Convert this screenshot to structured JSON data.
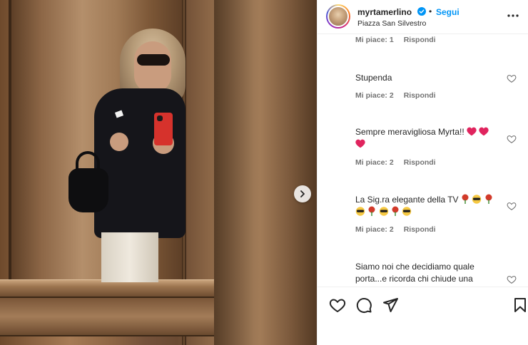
{
  "post": {
    "username": "myrtamerlino",
    "follow_label": "Segui",
    "separator": "•",
    "location": "Piazza San Silvestro"
  },
  "comments": [
    {
      "text": "",
      "likes_label": "Mi piace: 1",
      "reply_label": "Rispondi"
    },
    {
      "text": "Stupenda",
      "likes_label": "Mi piace: 2",
      "reply_label": "Rispondi"
    },
    {
      "text": "Sempre meravigliosa Myrta!!",
      "likes_label": "Mi piace: 2",
      "reply_label": "Rispondi"
    },
    {
      "text": "La Sig.ra elegante della TV",
      "likes_label": "Mi piace: 2",
      "reply_label": "Rispondi"
    },
    {
      "text_line1": "Siamo noi che decidiamo quale",
      "text_line2": "porta...e ricorda chi chiude una"
    }
  ],
  "icons": {
    "verified": "verified-badge-icon",
    "more": "more-options-icon",
    "next": "chevron-right-icon",
    "like": "heart-icon",
    "comment": "comment-icon",
    "share": "paper-plane-icon",
    "save": "bookmark-icon",
    "heart_emoji": "red-heart-emoji",
    "rose": "rose-emoji",
    "sunglasses": "sunglasses-emoji"
  },
  "colors": {
    "accent": "#0095f6",
    "text": "#262626",
    "muted": "#737373",
    "heart_red": "#e0245e"
  }
}
